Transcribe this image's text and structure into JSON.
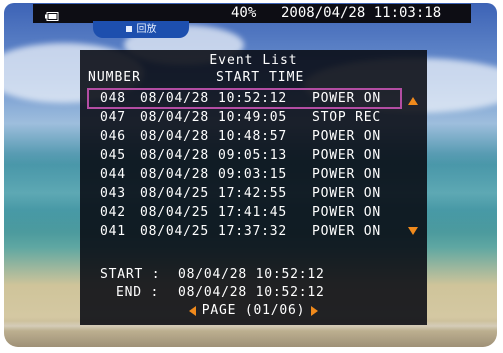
{
  "status_bar": {
    "battery_icon": "battery-icon",
    "level": "40%",
    "datetime": "2008/04/28 11:03:18"
  },
  "mode_chip": {
    "icon": "square-icon",
    "label": "回放"
  },
  "event_list": {
    "title": "Event List",
    "columns": [
      "NUMBER",
      "START TIME"
    ],
    "rows": [
      {
        "number": "048",
        "date": "08/04/28",
        "time": "10:52:12",
        "event": "POWER ON",
        "selected": true
      },
      {
        "number": "047",
        "date": "08/04/28",
        "time": "10:49:05",
        "event": "STOP REC",
        "selected": false
      },
      {
        "number": "046",
        "date": "08/04/28",
        "time": "10:48:57",
        "event": "POWER ON",
        "selected": false
      },
      {
        "number": "045",
        "date": "08/04/28",
        "time": "09:05:13",
        "event": "POWER ON",
        "selected": false
      },
      {
        "number": "044",
        "date": "08/04/28",
        "time": "09:03:15",
        "event": "POWER ON",
        "selected": false
      },
      {
        "number": "043",
        "date": "08/04/25",
        "time": "17:42:55",
        "event": "POWER ON",
        "selected": false
      },
      {
        "number": "042",
        "date": "08/04/25",
        "time": "17:41:45",
        "event": "POWER ON",
        "selected": false
      },
      {
        "number": "041",
        "date": "08/04/25",
        "time": "17:37:32",
        "event": "POWER ON",
        "selected": false
      }
    ],
    "scroll_up_icon": "triangle-up-icon",
    "scroll_down_icon": "triangle-down-icon",
    "detail": {
      "start_label": "START :",
      "start_value": "08/04/28 10:52:12",
      "end_label": "END :",
      "end_value": "08/04/28 10:52:12"
    },
    "page": {
      "label": "PAGE (01/06)",
      "prev_icon": "triangle-left-icon",
      "next_icon": "triangle-right-icon"
    }
  },
  "colors": {
    "accent": "#f08a1c",
    "selection": "#b34da3",
    "chip": "#1d4fae"
  }
}
